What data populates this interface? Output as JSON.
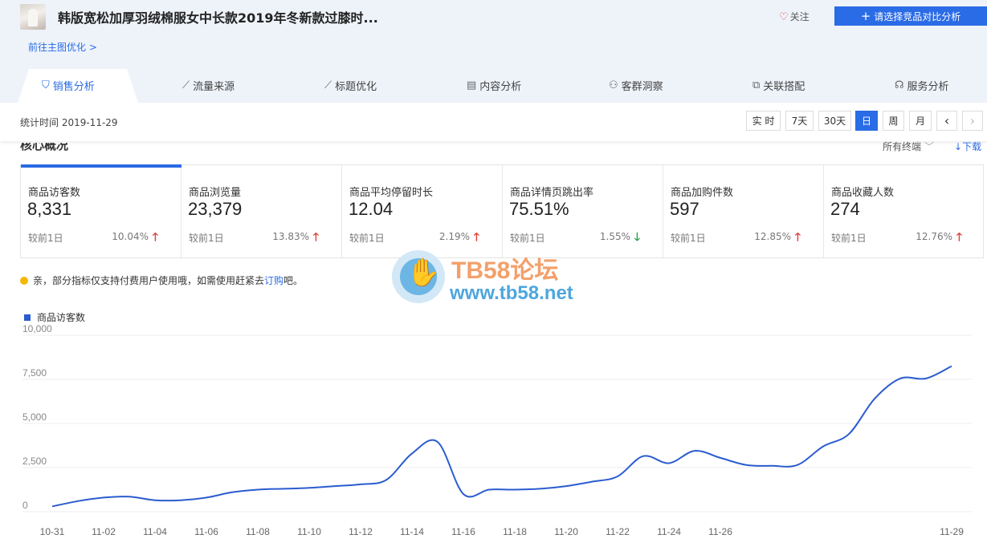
{
  "product": {
    "title": "韩版宽松加厚羽绒棉服女中长款2019年冬新款过膝时...",
    "follow_label": "关注",
    "compare_label": "请选择竞品对比分析",
    "link_main_image": "前往主图优化 >"
  },
  "tabs": [
    {
      "label": "销售分析",
      "icon": "bag-icon"
    },
    {
      "label": "流量来源",
      "icon": "trend-icon"
    },
    {
      "label": "标题优化",
      "icon": "trend-icon"
    },
    {
      "label": "内容分析",
      "icon": "document-icon"
    },
    {
      "label": "客群洞察",
      "icon": "users-icon"
    },
    {
      "label": "关联搭配",
      "icon": "link-icon"
    },
    {
      "label": "服务分析",
      "icon": "headset-icon"
    }
  ],
  "stat": {
    "time_label": "统计时间 2019-11-29",
    "ranges": [
      "实 时",
      "7天",
      "30天",
      "日",
      "周",
      "月"
    ],
    "active_range": "日",
    "prev": "‹",
    "next": "›"
  },
  "core": {
    "title": "核心概况",
    "terminal": "所有终端",
    "download": "下载"
  },
  "metrics": [
    {
      "name": "商品访客数",
      "value": "8,331",
      "compare": "较前1日",
      "pct": "10.04%",
      "dir": "up"
    },
    {
      "name": "商品浏览量",
      "value": "23,379",
      "compare": "较前1日",
      "pct": "13.83%",
      "dir": "up"
    },
    {
      "name": "商品平均停留时长",
      "value": "12.04",
      "compare": "较前1日",
      "pct": "2.19%",
      "dir": "up"
    },
    {
      "name": "商品详情页跳出率",
      "value": "75.51%",
      "compare": "较前1日",
      "pct": "1.55%",
      "dir": "down"
    },
    {
      "name": "商品加购件数",
      "value": "597",
      "compare": "较前1日",
      "pct": "12.85%",
      "dir": "up"
    },
    {
      "name": "商品收藏人数",
      "value": "274",
      "compare": "较前1日",
      "pct": "12.76%",
      "dir": "up"
    }
  ],
  "notice": {
    "text": "亲，部分指标仅支持付费用户使用哦，如需使用赶紧去",
    "link": "订购",
    "suffix": "吧。"
  },
  "watermark": {
    "text1": "TB58论坛",
    "text2": "www.tb58.net"
  },
  "colors": {
    "accent": "#2a6be6",
    "line": "#2a5ccf",
    "up": "#e0403a",
    "down": "#2aa34a"
  },
  "chart_data": {
    "type": "line",
    "legend": "商品访客数",
    "series": [
      {
        "name": "商品访客数",
        "values": [
          300,
          600,
          800,
          850,
          650,
          650,
          800,
          1100,
          1250,
          1300,
          1350,
          1450,
          1550,
          1800,
          3300,
          3950,
          1000,
          1250,
          1250,
          1300,
          1450,
          1700,
          2000,
          3150,
          2750,
          3450,
          3050,
          2650,
          2600,
          2650,
          3700,
          4400,
          6400,
          7550,
          7550,
          8250
        ]
      }
    ],
    "ylim": [
      0,
      10000
    ],
    "yticks": [
      "0",
      "2,500",
      "5,000",
      "7,500",
      "10,000"
    ],
    "xticks": [
      "10-31",
      "11-02",
      "11-04",
      "11-06",
      "11-08",
      "11-10",
      "11-12",
      "11-14",
      "11-16",
      "11-18",
      "11-20",
      "11-22",
      "11-24",
      "11-26",
      "11-29"
    ],
    "grid": true
  }
}
